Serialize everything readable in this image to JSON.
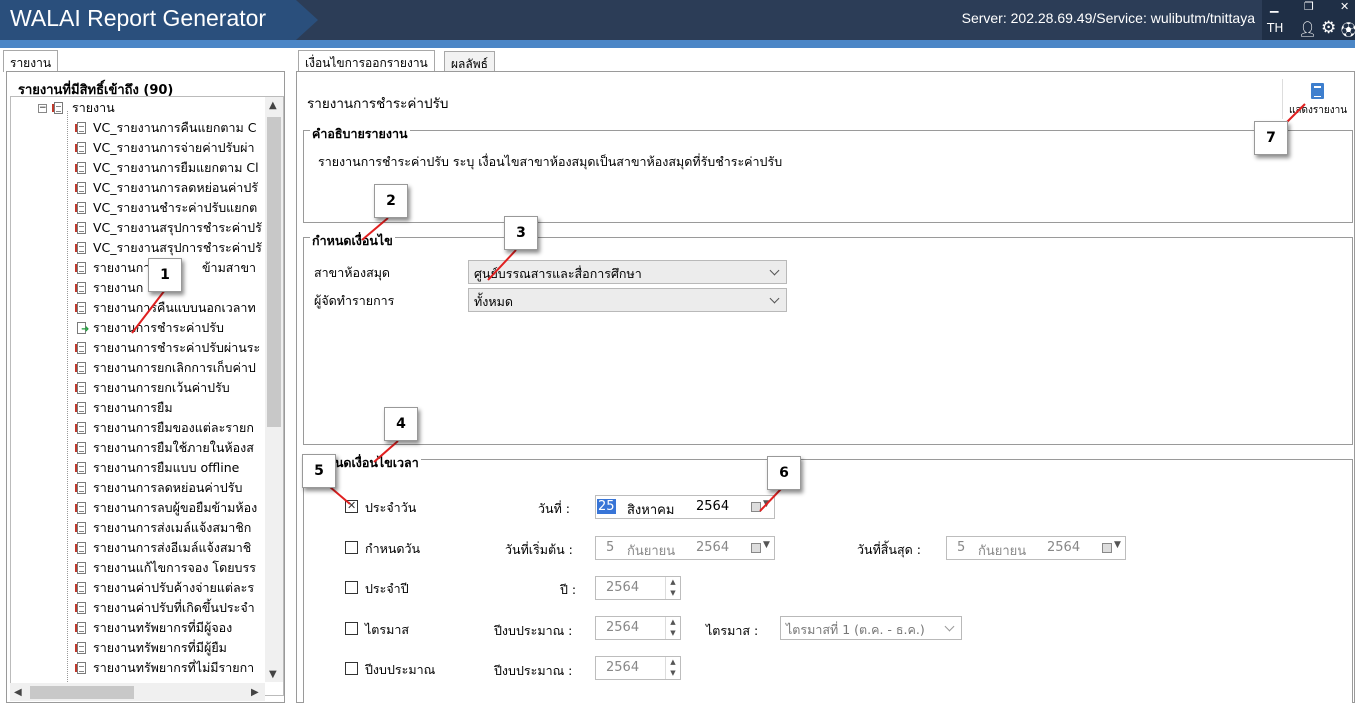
{
  "app": {
    "title": "WALAI Report Generator",
    "server": "Server: 202.28.69.49/Service: wulibutm/tnittaya",
    "language": "TH"
  },
  "left": {
    "tab": "รายงาน",
    "tree_header": "รายงานที่มีสิทธิ์เข้าถึง (90)",
    "folder": "รายงาน",
    "items": [
      "VC_รายงานการคืนแยกตาม C",
      "VC_รายงานการจ่ายค่าปรับผ่า",
      "VC_รายงานการยืมแยกตาม Cl",
      "VC_รายงานการลดหย่อนค่าปรั",
      "VC_รายงานชำระค่าปรับแยกต",
      "VC_รายงานสรุปการชำระค่าปรั",
      "VC_รายงานสรุปการชำระค่าปรั",
      "รายงานการ",
      "รายงานก",
      "รายงานการคืนแบบนอกเวลาท",
      "รายงานการชำระค่าปรับ",
      "รายงานการชำระค่าปรับผ่านระ",
      "รายงานการยกเลิกการเก็บค่าป",
      "รายงานการยกเว้นค่าปรับ",
      "รายงานการยืม",
      "รายงานการยืมของแต่ละรายก",
      "รายงานการยืมใช้ภายในห้องส",
      "รายงานการยืมแบบ offline",
      "รายงานการลดหย่อนค่าปรับ",
      "รายงานการลบผู้ขอยืมข้ามห้อง",
      "รายงานการส่งเมล์แจ้งสมาชิก",
      "รายงานการส่งอีเมล์แจ้งสมาชิ",
      "รายงานแก้ไขการจอง โดยบรร",
      "รายงานค่าปรับค้างจ่ายแต่ละร",
      "รายงานค่าปรับที่เกิดขึ้นประจำ",
      "รายงานทรัพยากรที่มีผู้จอง",
      "รายงานทรัพยากรที่มีผู้ยืม",
      "รายงานทรัพยากรที่ไม่มีรายกา"
    ],
    "partial_item": "ข้ามสาขา"
  },
  "right": {
    "tabs": [
      "เงื่อนไขการออกรายงาน",
      "ผลลัพธ์"
    ],
    "report_title": "รายงานการชำระค่าปรับ",
    "show_report_label": "แสดงรายงาน",
    "description": {
      "title": "คำอธิบายรายงาน",
      "text": "รายงานการชำระค่าปรับ ระบุ เงื่อนไขสาขาห้องสมุดเป็นสาขาห้องสมุดที่รับชำระค่าปรับ"
    },
    "conditions": {
      "title": "กำหนดเงื่อนไข",
      "branch_label": "สาขาห้องสมุด",
      "branch_value": "ศูนย์บรรณสารและสื่อการศึกษา",
      "creator_label": "ผู้จัดทำรายการ",
      "creator_value": "ทั้งหมด"
    },
    "time": {
      "title": "กำหนดเงื่อนไขเวลา",
      "daily": {
        "label": "ประจำวัน",
        "checked": true,
        "field_label": "วันที่ :",
        "day": "25",
        "month": "สิงหาคม",
        "year": "2564"
      },
      "range": {
        "label": "กำหนดวัน",
        "checked": false,
        "start_label": "วันที่เริ่มต้น :",
        "start_day": "5",
        "start_month": "กันยายน",
        "start_year": "2564",
        "end_label": "วันที่สิ้นสุด :",
        "end_day": "5",
        "end_month": "กันยายน",
        "end_year": "2564"
      },
      "year": {
        "label": "ประจำปี",
        "checked": false,
        "field_label": "ปี :",
        "value": "2564"
      },
      "quarter": {
        "label": "ไตรมาส",
        "checked": false,
        "field_label": "ปีงบประมาณ :",
        "value": "2564",
        "quarter_label": "ไตรมาส :",
        "quarter_value": "ไตรมาสที่ 1 (ต.ค. - ธ.ค.)"
      },
      "fiscal": {
        "label": "ปีงบประมาณ",
        "checked": false,
        "field_label": "ปีงบประมาณ :",
        "value": "2564"
      }
    }
  },
  "callouts": [
    "1",
    "2",
    "3",
    "4",
    "5",
    "6",
    "7"
  ],
  "colors": {
    "header_bg": "#2c3d57",
    "title_bg": "#2a4f7c",
    "accent": "#4b86c6",
    "callout_line": "#e02020"
  }
}
